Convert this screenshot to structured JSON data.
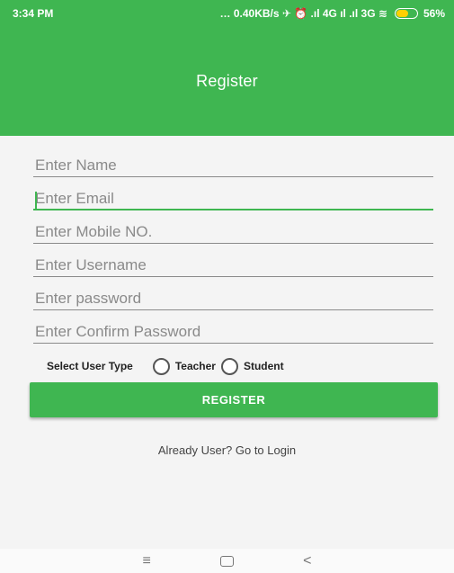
{
  "status_bar": {
    "time": "3:34 PM",
    "indicators": "… 0.40KB/s ✈ ⏰ .ıl 4G ıl .ıl 3G ≋",
    "battery_percent": "56%",
    "battery_level": 0.56
  },
  "app_bar": {
    "title": "Register"
  },
  "form": {
    "name_placeholder": "Enter Name",
    "email_placeholder": "Enter Email",
    "mobile_placeholder": "Enter Mobile NO.",
    "username_placeholder": "Enter Username",
    "password_placeholder": "Enter password",
    "confirm_placeholder": "Enter Confirm Password",
    "user_type_label": "Select User Type",
    "option_teacher": "Teacher",
    "option_student": "Student",
    "register_label": "REGISTER",
    "login_link": "Already User? Go to Login"
  },
  "nav_bar": {
    "menu_icon": "menu-icon",
    "home_icon": "home-icon",
    "back_icon": "back-icon"
  },
  "colors": {
    "primary": "#3fb651",
    "background": "#f4f4f4"
  }
}
